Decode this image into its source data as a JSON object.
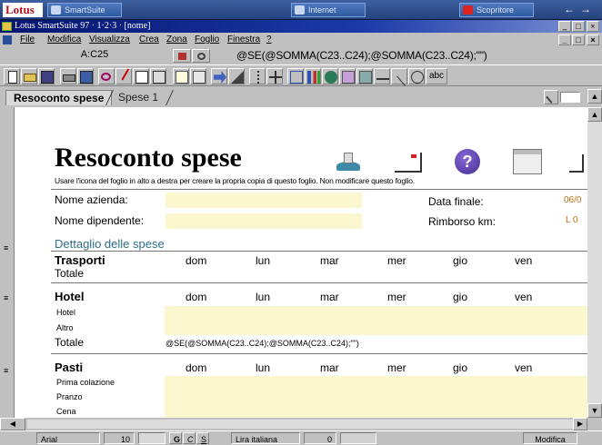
{
  "suite": {
    "logo": "Lotus",
    "smartsuite": "SmartSuite",
    "internet": "Internet",
    "app": "Scopritore"
  },
  "window": {
    "title": "Lotus SmartSuite 97 · 1·2·3 · [nome]",
    "minimize": "_",
    "restore": "□",
    "close": "×"
  },
  "menu": {
    "items": [
      "File",
      "Modifica",
      "Visualizza",
      "Crea",
      "Zona",
      "Foglio",
      "Finestra",
      "?"
    ]
  },
  "formula_bar": {
    "cell_ref": "A:C25",
    "formula": "@SE(@SOMMA(C23..C24);@SOMMA(C23..C24);\"\")"
  },
  "toolbar": {
    "text_button": "abc"
  },
  "sheet_tabs": [
    "Resoconto spese",
    "Spese 1"
  ],
  "doc": {
    "title": "Resoconto spese",
    "subtitle": "Usare l'icona del foglio in alto a destra per creare la propria copia di questo foglio. Non modificare questo foglio.",
    "company_label": "Nome azienda:",
    "employee_label": "Nome dipendente:",
    "end_date_label": "Data finale:",
    "end_date_value": "06/0",
    "km_label": "Rimborso km:",
    "km_value": "L 0",
    "details_label": "Dettaglio delle spese",
    "days": [
      "dom",
      "lun",
      "mar",
      "mer",
      "gio",
      "ven"
    ],
    "sections": [
      {
        "heading": "Trasporti",
        "rows": [],
        "total": "Totale"
      },
      {
        "heading": "Hotel",
        "rows": [
          "Hotel",
          "Altro"
        ],
        "total": "Totale",
        "total_formula": "@SE(@SOMMA(C23..C24);@SOMMA(C23..C24);\"\")"
      },
      {
        "heading": "Pasti",
        "rows": [
          "Prima colazione",
          "Pranzo",
          "Cena"
        ],
        "total": ""
      }
    ]
  },
  "status": {
    "font": "Arial",
    "size": "10",
    "bold": "G",
    "italic": "C",
    "underline": "S",
    "format": "Lira italiana",
    "decimals": "0",
    "mode": "Modifica"
  },
  "colors": {
    "yellow_field": "#fbf8cf",
    "teal_text": "#2f6d88",
    "title_bar": "#05146e"
  }
}
